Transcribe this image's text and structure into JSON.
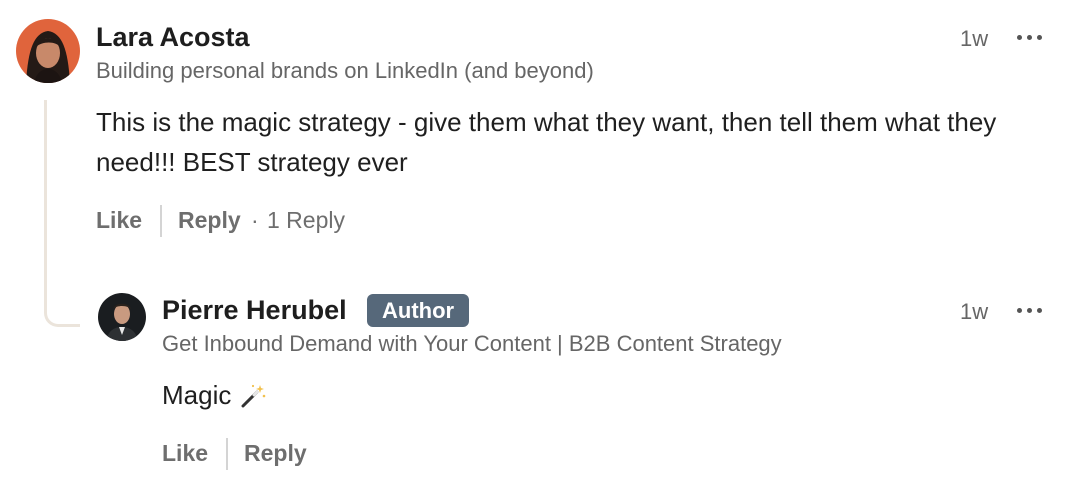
{
  "comment": {
    "author": "Lara Acosta",
    "headline": "Building personal brands on LinkedIn (and beyond)",
    "text": "This is the magic strategy - give them what they want, then tell them what they need!!! BEST strategy ever",
    "time": "1w",
    "like_label": "Like",
    "reply_label": "Reply",
    "reply_count": "1 Reply",
    "separator": "·"
  },
  "reply": {
    "author": "Pierre Herubel",
    "badge": "Author",
    "headline": "Get Inbound Demand with Your Content | B2B Content Strategy",
    "text": "Magic",
    "emoji_icon": "magic-wand-icon",
    "time": "1w",
    "like_label": "Like",
    "reply_label": "Reply"
  },
  "colors": {
    "badge_bg": "#56687a",
    "thread_line": "#ebe4db",
    "secondary_text": "#666666"
  }
}
